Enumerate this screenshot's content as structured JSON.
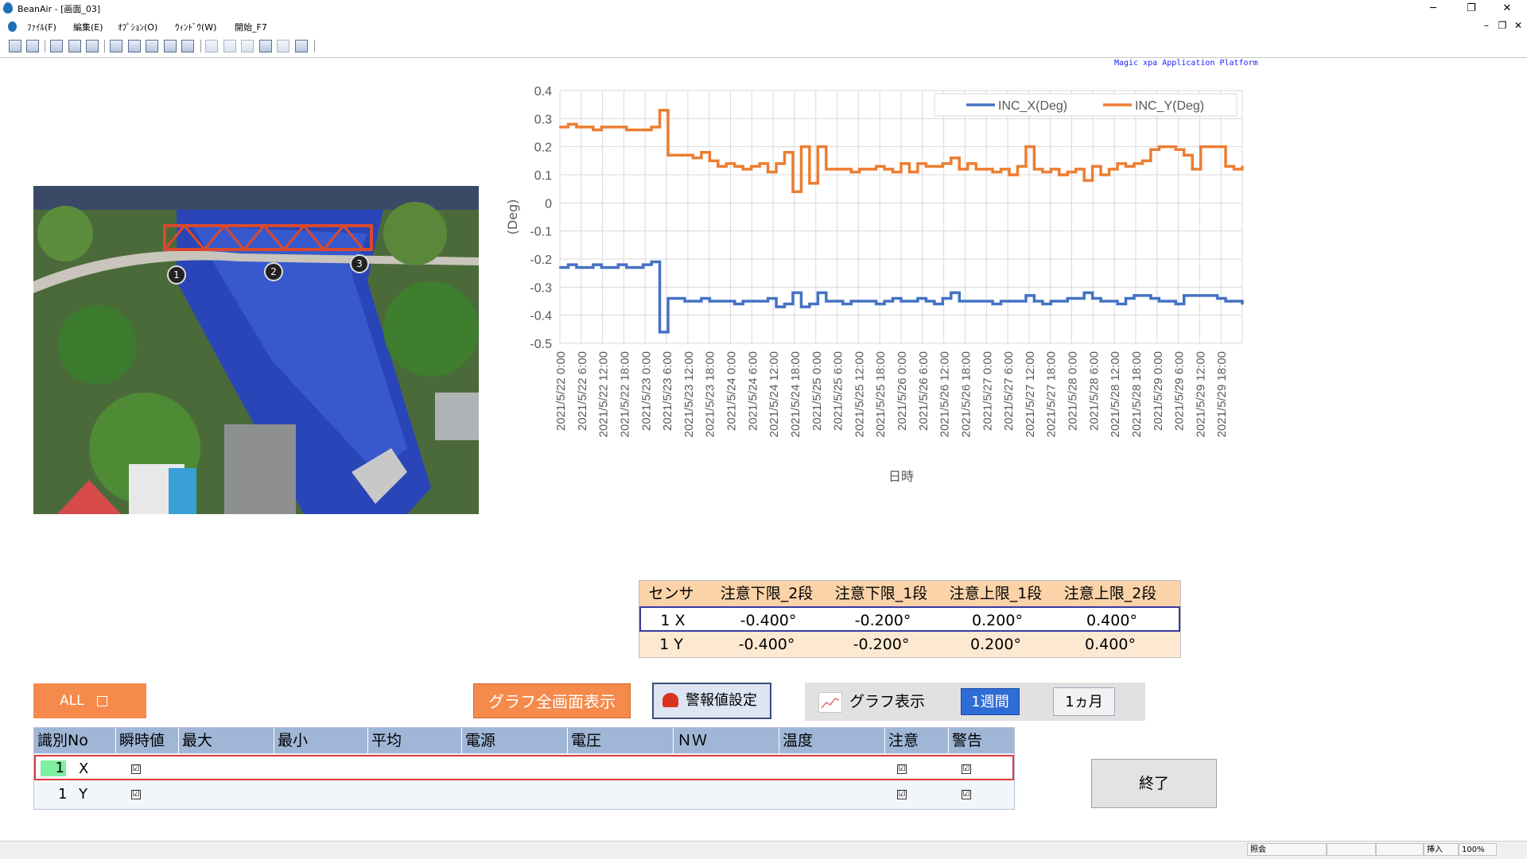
{
  "window": {
    "title": "BeanAir - [画面_03]",
    "minimize": "─",
    "maximize": "❐",
    "close": "✕"
  },
  "menu": {
    "items": [
      "ﾌｧｲﾙ(F)",
      "編集(E)",
      "ｵﾌﾟｼｮﾝ(O)",
      "ｳｨﾝﾄﾞｳ(W)",
      "開始_F7"
    ],
    "mdi_min": "–",
    "mdi_restore": "❐",
    "mdi_close": "✕"
  },
  "platform_label": "Magic xpa Application Platform",
  "photo": {
    "markers": [
      "1",
      "2",
      "3"
    ]
  },
  "chart_data": {
    "type": "line",
    "xlabel": "日時",
    "ylabel": "(Deg)",
    "ylim": [
      -0.5,
      0.4
    ],
    "yticks": [
      "0.4",
      "0.3",
      "0.2",
      "0.1",
      "0",
      "-0.1",
      "-0.2",
      "-0.3",
      "-0.4",
      "-0.5"
    ],
    "x_tick_labels": [
      "2021/5/22 0:00",
      "2021/5/22 6:00",
      "2021/5/22 12:00",
      "2021/5/22 18:00",
      "2021/5/23 0:00",
      "2021/5/23 6:00",
      "2021/5/23 12:00",
      "2021/5/23 18:00",
      "2021/5/24 0:00",
      "2021/5/24 6:00",
      "2021/5/24 12:00",
      "2021/5/24 18:00",
      "2021/5/25 0:00",
      "2021/5/25 6:00",
      "2021/5/25 12:00",
      "2021/5/25 18:00",
      "2021/5/26 0:00",
      "2021/5/26 6:00",
      "2021/5/26 12:00",
      "2021/5/26 18:00",
      "2021/5/27 0:00",
      "2021/5/27 6:00",
      "2021/5/27 12:00",
      "2021/5/27 18:00",
      "2021/5/28 0:00",
      "2021/5/28 6:00",
      "2021/5/28 12:00",
      "2021/5/28 18:00",
      "2021/5/29 0:00",
      "2021/5/29 6:00",
      "2021/5/29 12:00",
      "2021/5/29 18:00"
    ],
    "grid": true,
    "legend_position": "top-right",
    "series": [
      {
        "name": "INC_X(Deg)",
        "color": "#4472c4",
        "values": [
          -0.23,
          -0.22,
          -0.23,
          -0.23,
          -0.22,
          -0.23,
          -0.23,
          -0.22,
          -0.23,
          -0.23,
          -0.22,
          -0.21,
          -0.46,
          -0.34,
          -0.34,
          -0.35,
          -0.35,
          -0.34,
          -0.35,
          -0.35,
          -0.35,
          -0.36,
          -0.35,
          -0.35,
          -0.35,
          -0.34,
          -0.37,
          -0.36,
          -0.32,
          -0.37,
          -0.36,
          -0.32,
          -0.35,
          -0.35,
          -0.36,
          -0.35,
          -0.35,
          -0.35,
          -0.36,
          -0.35,
          -0.34,
          -0.35,
          -0.35,
          -0.34,
          -0.35,
          -0.36,
          -0.34,
          -0.32,
          -0.35,
          -0.35,
          -0.35,
          -0.35,
          -0.36,
          -0.35,
          -0.35,
          -0.35,
          -0.33,
          -0.35,
          -0.36,
          -0.35,
          -0.35,
          -0.34,
          -0.34,
          -0.32,
          -0.34,
          -0.35,
          -0.35,
          -0.36,
          -0.34,
          -0.33,
          -0.33,
          -0.34,
          -0.35,
          -0.35,
          -0.36,
          -0.33,
          -0.33,
          -0.33,
          -0.33,
          -0.34,
          -0.35,
          -0.35,
          -0.36
        ]
      },
      {
        "name": "INC_Y(Deg)",
        "color": "#ed7d31",
        "values": [
          0.27,
          0.28,
          0.27,
          0.27,
          0.26,
          0.27,
          0.27,
          0.27,
          0.26,
          0.26,
          0.26,
          0.27,
          0.33,
          0.17,
          0.17,
          0.17,
          0.16,
          0.18,
          0.15,
          0.13,
          0.14,
          0.13,
          0.12,
          0.13,
          0.14,
          0.11,
          0.14,
          0.18,
          0.04,
          0.2,
          0.07,
          0.2,
          0.12,
          0.12,
          0.12,
          0.11,
          0.12,
          0.12,
          0.13,
          0.12,
          0.11,
          0.14,
          0.11,
          0.14,
          0.13,
          0.13,
          0.14,
          0.16,
          0.12,
          0.14,
          0.12,
          0.12,
          0.11,
          0.12,
          0.1,
          0.13,
          0.2,
          0.12,
          0.11,
          0.12,
          0.1,
          0.11,
          0.12,
          0.08,
          0.13,
          0.1,
          0.12,
          0.14,
          0.13,
          0.14,
          0.15,
          0.19,
          0.2,
          0.2,
          0.19,
          0.17,
          0.12,
          0.2,
          0.2,
          0.2,
          0.13,
          0.12,
          0.13
        ]
      }
    ]
  },
  "thresholds": {
    "headers": [
      "センサ",
      "注意下限_2段",
      "注意下限_1段",
      "注意上限_1段",
      "注意上限_2段"
    ],
    "rows": [
      {
        "sensor": "1  X",
        "v1": "-0.400°",
        "v2": "-0.200°",
        "v3": "0.200°",
        "v4": "0.400°"
      },
      {
        "sensor": "1  Y",
        "v1": "-0.400°",
        "v2": "-0.200°",
        "v3": "0.200°",
        "v4": "0.400°"
      }
    ]
  },
  "controls": {
    "all_label": "ALL",
    "fullscreen_graph": "グラフ全画面表示",
    "alarm_setting": "警報値設定",
    "graph_display": "グラフ表示",
    "week": "1週間",
    "month": "1ヵ月",
    "exit": "終了"
  },
  "grid": {
    "headers": [
      "識別No",
      "瞬時値",
      "最大",
      "最小",
      "平均",
      "電源",
      "電圧",
      "ＮＷ",
      "温度",
      "注意",
      "警告"
    ],
    "rows": [
      {
        "id": "1",
        "axis": "X",
        "instant": "☑",
        "caution": "☑",
        "warning": "☑"
      },
      {
        "id": "1",
        "axis": "Y",
        "instant": "☑",
        "caution": "☑",
        "warning": "☑"
      }
    ]
  },
  "statusbar": {
    "mode": "照会",
    "insert": "挿入",
    "zoom": "100%"
  }
}
